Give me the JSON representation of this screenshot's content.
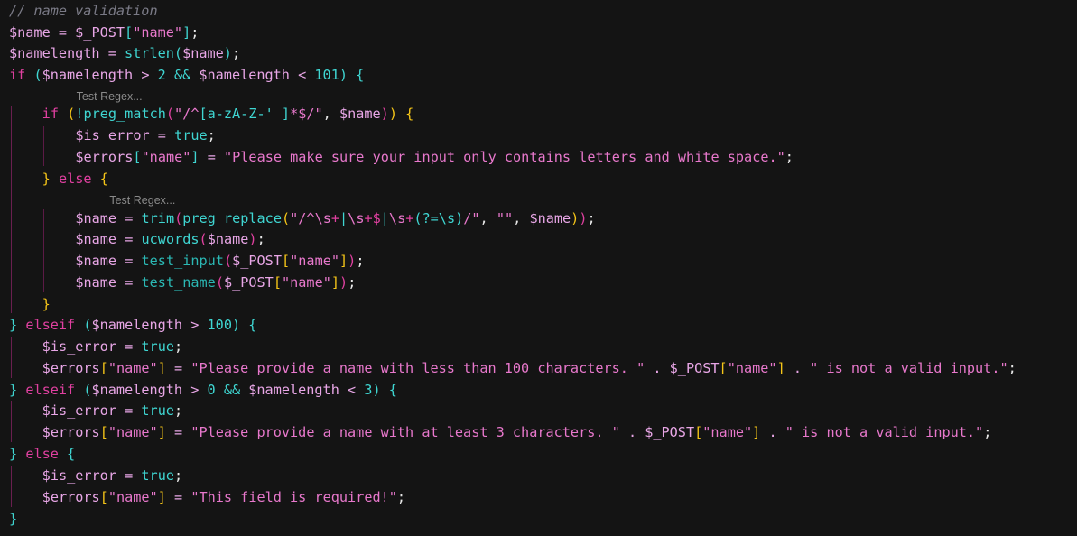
{
  "editor": {
    "language": "php",
    "codelens_label": "Test Regex...",
    "lines": [
      {
        "indent": 0,
        "tokens": [
          {
            "t": "// name validation",
            "c": "comment"
          }
        ]
      },
      {
        "indent": 0,
        "tokens": [
          {
            "t": "$name",
            "c": "var"
          },
          {
            "t": " = ",
            "c": "op"
          },
          {
            "t": "$_POST",
            "c": "var"
          },
          {
            "t": "[",
            "c": "b3"
          },
          {
            "t": "\"name\"",
            "c": "str"
          },
          {
            "t": "]",
            "c": "b3"
          },
          {
            "t": ";",
            "c": "punc"
          }
        ]
      },
      {
        "indent": 0,
        "tokens": [
          {
            "t": "$namelength",
            "c": "var"
          },
          {
            "t": " = ",
            "c": "op"
          },
          {
            "t": "strlen",
            "c": "fn"
          },
          {
            "t": "(",
            "c": "b3"
          },
          {
            "t": "$name",
            "c": "var"
          },
          {
            "t": ")",
            "c": "b3"
          },
          {
            "t": ";",
            "c": "punc"
          }
        ]
      },
      {
        "indent": 0,
        "tokens": [
          {
            "t": "if",
            "c": "kw"
          },
          {
            "t": " ",
            "c": "op"
          },
          {
            "t": "(",
            "c": "b3"
          },
          {
            "t": "$namelength",
            "c": "var"
          },
          {
            "t": " > ",
            "c": "op"
          },
          {
            "t": "2",
            "c": "num"
          },
          {
            "t": " && ",
            "c": "fn"
          },
          {
            "t": "$namelength",
            "c": "var"
          },
          {
            "t": " < ",
            "c": "op"
          },
          {
            "t": "101",
            "c": "num"
          },
          {
            "t": ")",
            "c": "b3"
          },
          {
            "t": " ",
            "c": "op"
          },
          {
            "t": "{",
            "c": "b3"
          }
        ]
      },
      {
        "lens": true,
        "indent": 1
      },
      {
        "indent": 1,
        "tokens": [
          {
            "t": "if",
            "c": "kw"
          },
          {
            "t": " ",
            "c": "op"
          },
          {
            "t": "(",
            "c": "b1"
          },
          {
            "t": "!",
            "c": "fn"
          },
          {
            "t": "preg_match",
            "c": "fn"
          },
          {
            "t": "(",
            "c": "b2"
          },
          {
            "t": "\"/^",
            "c": "str"
          },
          {
            "t": "[a-zA-Z-' ]",
            "c": "re"
          },
          {
            "t": "*$/\"",
            "c": "str"
          },
          {
            "t": ", ",
            "c": "punc"
          },
          {
            "t": "$name",
            "c": "var"
          },
          {
            "t": ")",
            "c": "b2"
          },
          {
            "t": ")",
            "c": "b1"
          },
          {
            "t": " ",
            "c": "op"
          },
          {
            "t": "{",
            "c": "b1"
          }
        ]
      },
      {
        "indent": 2,
        "tokens": [
          {
            "t": "$is_error",
            "c": "var"
          },
          {
            "t": " = ",
            "c": "op"
          },
          {
            "t": "true",
            "c": "const"
          },
          {
            "t": ";",
            "c": "punc"
          }
        ]
      },
      {
        "indent": 2,
        "tokens": [
          {
            "t": "$errors",
            "c": "var"
          },
          {
            "t": "[",
            "c": "b3"
          },
          {
            "t": "\"name\"",
            "c": "str"
          },
          {
            "t": "]",
            "c": "b3"
          },
          {
            "t": " = ",
            "c": "op"
          },
          {
            "t": "\"Please make sure your input only contains letters and white space.\"",
            "c": "str"
          },
          {
            "t": ";",
            "c": "punc"
          }
        ]
      },
      {
        "indent": 1,
        "tokens": [
          {
            "t": "}",
            "c": "b1"
          },
          {
            "t": " ",
            "c": "op"
          },
          {
            "t": "else",
            "c": "kw"
          },
          {
            "t": " ",
            "c": "op"
          },
          {
            "t": "{",
            "c": "b1"
          }
        ]
      },
      {
        "lens": true,
        "indent": 2
      },
      {
        "indent": 2,
        "tokens": [
          {
            "t": "$name",
            "c": "var"
          },
          {
            "t": " = ",
            "c": "op"
          },
          {
            "t": "trim",
            "c": "fn"
          },
          {
            "t": "(",
            "c": "b2"
          },
          {
            "t": "preg_replace",
            "c": "fn"
          },
          {
            "t": "(",
            "c": "b1"
          },
          {
            "t": "\"/^\\s",
            "c": "str"
          },
          {
            "t": "+",
            "c": "resp"
          },
          {
            "t": "|",
            "c": "re"
          },
          {
            "t": "\\s",
            "c": "str"
          },
          {
            "t": "+$",
            "c": "resp"
          },
          {
            "t": "|",
            "c": "re"
          },
          {
            "t": "\\s",
            "c": "str"
          },
          {
            "t": "+",
            "c": "resp"
          },
          {
            "t": "(?=\\s)",
            "c": "re"
          },
          {
            "t": "/\"",
            "c": "str"
          },
          {
            "t": ", ",
            "c": "punc"
          },
          {
            "t": "\"\"",
            "c": "str"
          },
          {
            "t": ", ",
            "c": "punc"
          },
          {
            "t": "$name",
            "c": "var"
          },
          {
            "t": ")",
            "c": "b1"
          },
          {
            "t": ")",
            "c": "b2"
          },
          {
            "t": ";",
            "c": "punc"
          }
        ]
      },
      {
        "indent": 2,
        "tokens": [
          {
            "t": "$name",
            "c": "var"
          },
          {
            "t": " = ",
            "c": "op"
          },
          {
            "t": "ucwords",
            "c": "fn"
          },
          {
            "t": "(",
            "c": "b2"
          },
          {
            "t": "$name",
            "c": "var"
          },
          {
            "t": ")",
            "c": "b2"
          },
          {
            "t": ";",
            "c": "punc"
          }
        ]
      },
      {
        "indent": 2,
        "tokens": [
          {
            "t": "$name",
            "c": "var"
          },
          {
            "t": " = ",
            "c": "op"
          },
          {
            "t": "test_input",
            "c": "fn2"
          },
          {
            "t": "(",
            "c": "b2"
          },
          {
            "t": "$_POST",
            "c": "var"
          },
          {
            "t": "[",
            "c": "b1"
          },
          {
            "t": "\"name\"",
            "c": "str"
          },
          {
            "t": "]",
            "c": "b1"
          },
          {
            "t": ")",
            "c": "b2"
          },
          {
            "t": ";",
            "c": "punc"
          }
        ]
      },
      {
        "indent": 2,
        "tokens": [
          {
            "t": "$name",
            "c": "var"
          },
          {
            "t": " = ",
            "c": "op"
          },
          {
            "t": "test_name",
            "c": "fn2"
          },
          {
            "t": "(",
            "c": "b2"
          },
          {
            "t": "$_POST",
            "c": "var"
          },
          {
            "t": "[",
            "c": "b1"
          },
          {
            "t": "\"name\"",
            "c": "str"
          },
          {
            "t": "]",
            "c": "b1"
          },
          {
            "t": ")",
            "c": "b2"
          },
          {
            "t": ";",
            "c": "punc"
          }
        ]
      },
      {
        "indent": 1,
        "tokens": [
          {
            "t": "}",
            "c": "b1"
          }
        ]
      },
      {
        "indent": 0,
        "tokens": [
          {
            "t": "}",
            "c": "b3"
          },
          {
            "t": " ",
            "c": "op"
          },
          {
            "t": "elseif",
            "c": "kw"
          },
          {
            "t": " ",
            "c": "op"
          },
          {
            "t": "(",
            "c": "b3"
          },
          {
            "t": "$namelength",
            "c": "var"
          },
          {
            "t": " > ",
            "c": "op"
          },
          {
            "t": "100",
            "c": "num"
          },
          {
            "t": ")",
            "c": "b3"
          },
          {
            "t": " ",
            "c": "op"
          },
          {
            "t": "{",
            "c": "b3"
          }
        ]
      },
      {
        "indent": 1,
        "tokens": [
          {
            "t": "$is_error",
            "c": "var"
          },
          {
            "t": " = ",
            "c": "op"
          },
          {
            "t": "true",
            "c": "const"
          },
          {
            "t": ";",
            "c": "punc"
          }
        ]
      },
      {
        "indent": 1,
        "tokens": [
          {
            "t": "$errors",
            "c": "var"
          },
          {
            "t": "[",
            "c": "b1"
          },
          {
            "t": "\"name\"",
            "c": "str"
          },
          {
            "t": "]",
            "c": "b1"
          },
          {
            "t": " = ",
            "c": "op"
          },
          {
            "t": "\"Please provide a name with less than 100 characters. \"",
            "c": "str"
          },
          {
            "t": " . ",
            "c": "op"
          },
          {
            "t": "$_POST",
            "c": "var"
          },
          {
            "t": "[",
            "c": "b1"
          },
          {
            "t": "\"name\"",
            "c": "str"
          },
          {
            "t": "]",
            "c": "b1"
          },
          {
            "t": " . ",
            "c": "op"
          },
          {
            "t": "\" is not a valid input.\"",
            "c": "str"
          },
          {
            "t": ";",
            "c": "punc"
          }
        ]
      },
      {
        "indent": 0,
        "tokens": [
          {
            "t": "}",
            "c": "b3"
          },
          {
            "t": " ",
            "c": "op"
          },
          {
            "t": "elseif",
            "c": "kw"
          },
          {
            "t": " ",
            "c": "op"
          },
          {
            "t": "(",
            "c": "b3"
          },
          {
            "t": "$namelength",
            "c": "var"
          },
          {
            "t": " > ",
            "c": "op"
          },
          {
            "t": "0",
            "c": "num"
          },
          {
            "t": " && ",
            "c": "fn"
          },
          {
            "t": "$namelength",
            "c": "var"
          },
          {
            "t": " < ",
            "c": "op"
          },
          {
            "t": "3",
            "c": "num"
          },
          {
            "t": ")",
            "c": "b3"
          },
          {
            "t": " ",
            "c": "op"
          },
          {
            "t": "{",
            "c": "b3"
          }
        ]
      },
      {
        "indent": 1,
        "tokens": [
          {
            "t": "$is_error",
            "c": "var"
          },
          {
            "t": " = ",
            "c": "op"
          },
          {
            "t": "true",
            "c": "const"
          },
          {
            "t": ";",
            "c": "punc"
          }
        ]
      },
      {
        "indent": 1,
        "tokens": [
          {
            "t": "$errors",
            "c": "var"
          },
          {
            "t": "[",
            "c": "b1"
          },
          {
            "t": "\"name\"",
            "c": "str"
          },
          {
            "t": "]",
            "c": "b1"
          },
          {
            "t": " = ",
            "c": "op"
          },
          {
            "t": "\"Please provide a name with at least 3 characters. \"",
            "c": "str"
          },
          {
            "t": " . ",
            "c": "op"
          },
          {
            "t": "$_POST",
            "c": "var"
          },
          {
            "t": "[",
            "c": "b1"
          },
          {
            "t": "\"name\"",
            "c": "str"
          },
          {
            "t": "]",
            "c": "b1"
          },
          {
            "t": " . ",
            "c": "op"
          },
          {
            "t": "\" is not a valid input.\"",
            "c": "str"
          },
          {
            "t": ";",
            "c": "punc"
          }
        ]
      },
      {
        "indent": 0,
        "tokens": [
          {
            "t": "}",
            "c": "b3"
          },
          {
            "t": " ",
            "c": "op"
          },
          {
            "t": "else",
            "c": "kw"
          },
          {
            "t": " ",
            "c": "op"
          },
          {
            "t": "{",
            "c": "b3"
          }
        ]
      },
      {
        "indent": 1,
        "tokens": [
          {
            "t": "$is_error",
            "c": "var"
          },
          {
            "t": " = ",
            "c": "op"
          },
          {
            "t": "true",
            "c": "const"
          },
          {
            "t": ";",
            "c": "punc"
          }
        ]
      },
      {
        "indent": 1,
        "tokens": [
          {
            "t": "$errors",
            "c": "var"
          },
          {
            "t": "[",
            "c": "b1"
          },
          {
            "t": "\"name\"",
            "c": "str"
          },
          {
            "t": "]",
            "c": "b1"
          },
          {
            "t": " = ",
            "c": "op"
          },
          {
            "t": "\"This field is required!\"",
            "c": "str"
          },
          {
            "t": ";",
            "c": "punc"
          }
        ]
      },
      {
        "indent": 0,
        "tokens": [
          {
            "t": "}",
            "c": "b3"
          }
        ]
      }
    ]
  }
}
